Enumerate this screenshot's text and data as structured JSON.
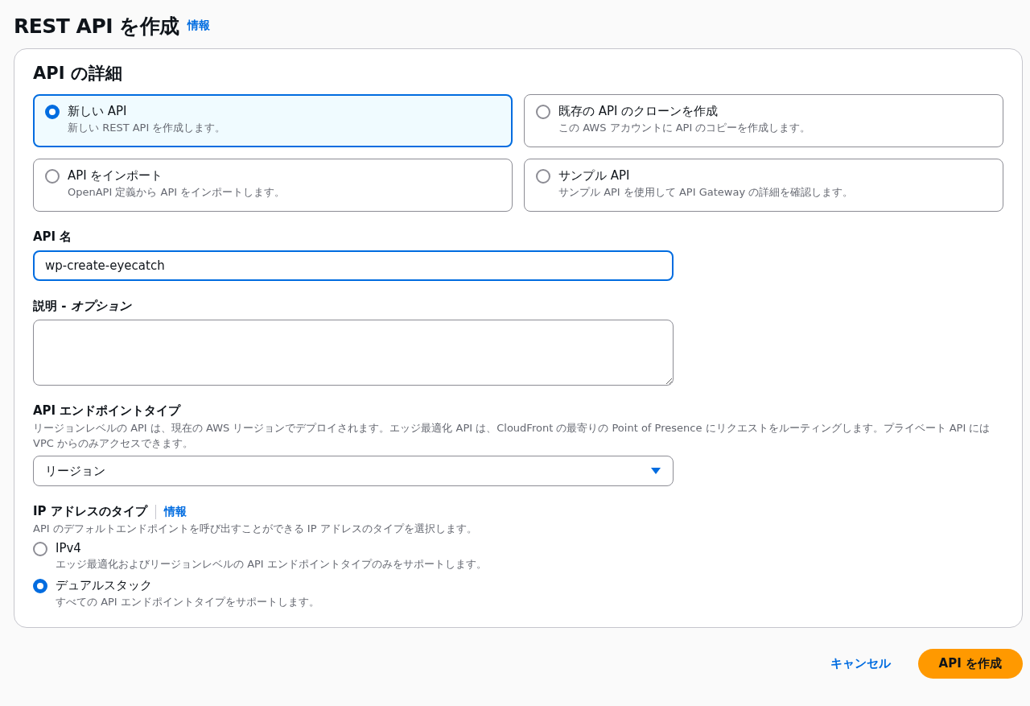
{
  "page": {
    "title": "REST API を作成",
    "info_link": "情報"
  },
  "api_details": {
    "heading": "API の詳細",
    "options": [
      {
        "label": "新しい API",
        "description": "新しい REST API を作成します。",
        "selected": true
      },
      {
        "label": "既存の API のクローンを作成",
        "description": "この AWS アカウントに API のコピーを作成します。",
        "selected": false
      },
      {
        "label": "API をインポート",
        "description": "OpenAPI 定義から API をインポートします。",
        "selected": false
      },
      {
        "label": "サンプル API",
        "description": "サンプル API を使用して API Gateway の詳細を確認します。",
        "selected": false
      }
    ],
    "api_name": {
      "label": "API 名",
      "value": "wp-create-eyecatch"
    },
    "description": {
      "label": "説明 - ",
      "optional": "オプション"
    },
    "endpoint_type": {
      "label": "API エンドポイントタイプ",
      "help": "リージョンレベルの API は、現在の AWS リージョンでデプロイされます。エッジ最適化 API は、CloudFront の最寄りの Point of Presence にリクエストをルーティングします。プライベート API には VPC からのみアクセスできます。",
      "value": "リージョン"
    },
    "ip_address_type": {
      "label": "IP アドレスのタイプ",
      "info_link": "情報",
      "help": "API のデフォルトエンドポイントを呼び出すことができる IP アドレスのタイプを選択します。",
      "options": [
        {
          "label": "IPv4",
          "description": "エッジ最適化およびリージョンレベルの API エンドポイントタイプのみをサポートします。",
          "selected": false
        },
        {
          "label": "デュアルスタック",
          "description": "すべての API エンドポイントタイプをサポートします。",
          "selected": true
        }
      ]
    }
  },
  "footer": {
    "cancel": "キャンセル",
    "submit": "API を作成"
  }
}
